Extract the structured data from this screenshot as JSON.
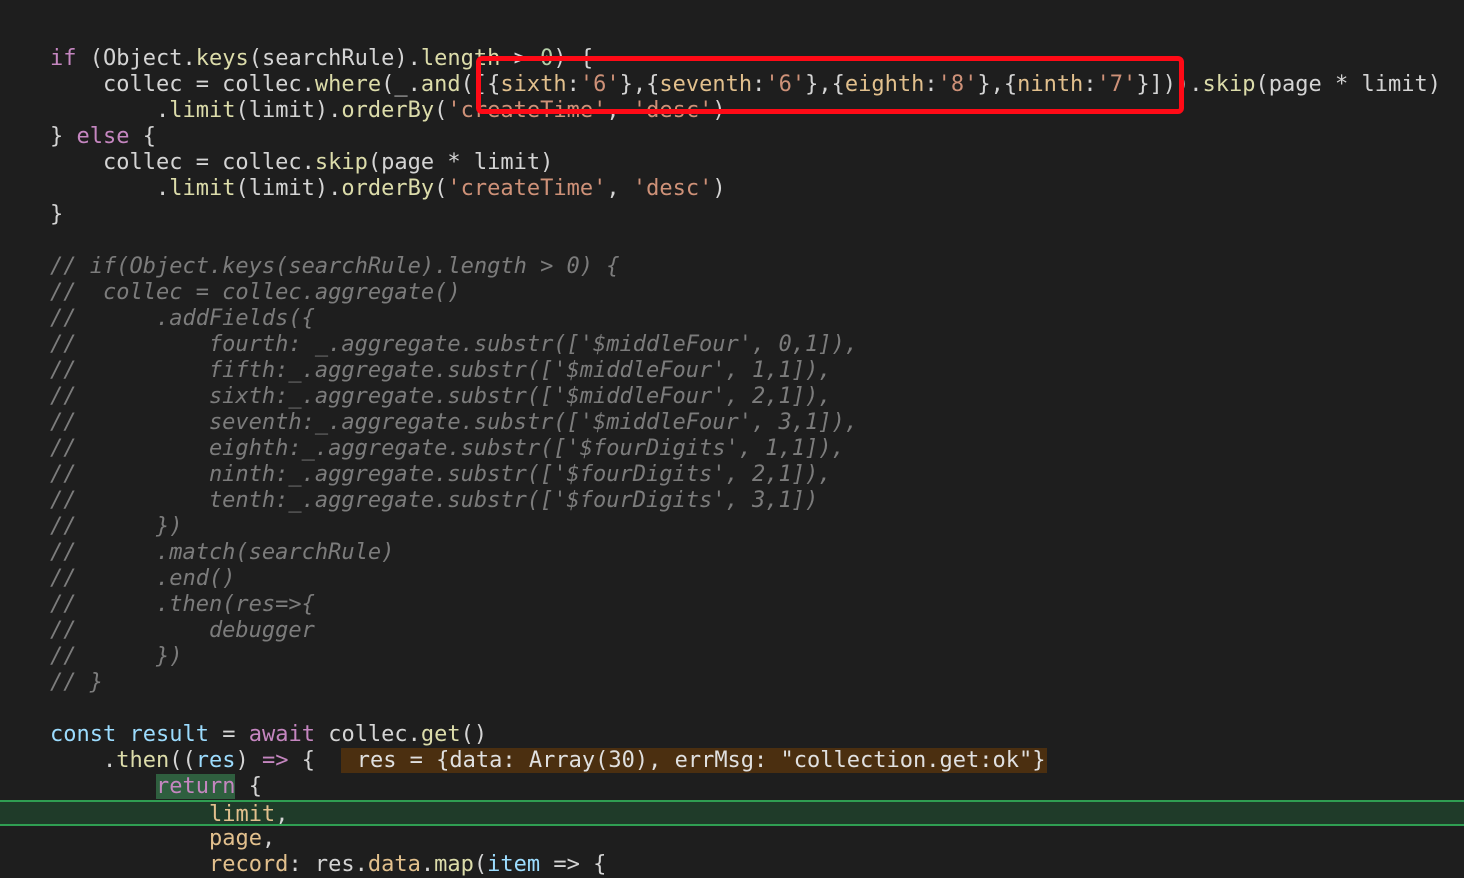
{
  "lines": [
    {
      "tokens": []
    },
    {
      "tokens": [
        {
          "t": "if",
          "c": "t-kw"
        },
        {
          "t": " (Object.",
          "c": "t-plain"
        },
        {
          "t": "keys",
          "c": "t-fn"
        },
        {
          "t": "(searchRule).",
          "c": "t-plain"
        },
        {
          "t": "length",
          "c": "t-fn"
        },
        {
          "t": " > ",
          "c": "t-op"
        },
        {
          "t": "0",
          "c": "t-num"
        },
        {
          "t": ") {",
          "c": "t-plain"
        }
      ]
    },
    {
      "tokens": [
        {
          "t": "    collec = collec.",
          "c": "t-plain"
        },
        {
          "t": "where",
          "c": "t-fn"
        },
        {
          "t": "(_.",
          "c": "t-plain"
        },
        {
          "t": "and",
          "c": "t-fn"
        },
        {
          "t": "([{",
          "c": "t-plain"
        },
        {
          "t": "sixth",
          "c": "t-prop"
        },
        {
          "t": ":",
          "c": "t-plain"
        },
        {
          "t": "'6'",
          "c": "t-str"
        },
        {
          "t": "},{",
          "c": "t-plain"
        },
        {
          "t": "seventh",
          "c": "t-prop"
        },
        {
          "t": ":",
          "c": "t-plain"
        },
        {
          "t": "'6'",
          "c": "t-str"
        },
        {
          "t": "},{",
          "c": "t-plain"
        },
        {
          "t": "eighth",
          "c": "t-prop"
        },
        {
          "t": ":",
          "c": "t-plain"
        },
        {
          "t": "'8'",
          "c": "t-str"
        },
        {
          "t": "},{",
          "c": "t-plain"
        },
        {
          "t": "ninth",
          "c": "t-prop"
        },
        {
          "t": ":",
          "c": "t-plain"
        },
        {
          "t": "'7'",
          "c": "t-str"
        },
        {
          "t": "}])).",
          "c": "t-plain"
        },
        {
          "t": "skip",
          "c": "t-fn"
        },
        {
          "t": "(page ",
          "c": "t-plain"
        },
        {
          "t": "*",
          "c": "t-op"
        },
        {
          "t": " limit)",
          "c": "t-plain"
        }
      ]
    },
    {
      "tokens": [
        {
          "t": "        .",
          "c": "t-plain"
        },
        {
          "t": "limit",
          "c": "t-fn"
        },
        {
          "t": "(limit).",
          "c": "t-plain"
        },
        {
          "t": "orderBy",
          "c": "t-fn"
        },
        {
          "t": "(",
          "c": "t-plain"
        },
        {
          "t": "'createTime'",
          "c": "t-str"
        },
        {
          "t": ", ",
          "c": "t-plain"
        },
        {
          "t": "'desc'",
          "c": "t-str"
        },
        {
          "t": ")",
          "c": "t-plain"
        }
      ]
    },
    {
      "tokens": [
        {
          "t": "} ",
          "c": "t-plain"
        },
        {
          "t": "else",
          "c": "t-kw"
        },
        {
          "t": " {",
          "c": "t-plain"
        }
      ]
    },
    {
      "tokens": [
        {
          "t": "    collec = collec.",
          "c": "t-plain"
        },
        {
          "t": "skip",
          "c": "t-fn"
        },
        {
          "t": "(page ",
          "c": "t-plain"
        },
        {
          "t": "*",
          "c": "t-op"
        },
        {
          "t": " limit)",
          "c": "t-plain"
        }
      ]
    },
    {
      "tokens": [
        {
          "t": "        .",
          "c": "t-plain"
        },
        {
          "t": "limit",
          "c": "t-fn"
        },
        {
          "t": "(limit).",
          "c": "t-plain"
        },
        {
          "t": "orderBy",
          "c": "t-fn"
        },
        {
          "t": "(",
          "c": "t-plain"
        },
        {
          "t": "'createTime'",
          "c": "t-str"
        },
        {
          "t": ", ",
          "c": "t-plain"
        },
        {
          "t": "'desc'",
          "c": "t-str"
        },
        {
          "t": ")",
          "c": "t-plain"
        }
      ]
    },
    {
      "tokens": [
        {
          "t": "}",
          "c": "t-plain"
        }
      ]
    },
    {
      "tokens": []
    },
    {
      "tokens": [
        {
          "t": "// if(Object.keys(searchRule).length > 0) {",
          "c": "t-cmt"
        }
      ]
    },
    {
      "tokens": [
        {
          "t": "//  collec = collec.aggregate()",
          "c": "t-cmt"
        }
      ]
    },
    {
      "tokens": [
        {
          "t": "//      .addFields({",
          "c": "t-cmt"
        }
      ]
    },
    {
      "tokens": [
        {
          "t": "//          fourth: _.aggregate.substr(['$middleFour', 0,1]),",
          "c": "t-cmt"
        }
      ]
    },
    {
      "tokens": [
        {
          "t": "//          fifth:_.aggregate.substr(['$middleFour', 1,1]),",
          "c": "t-cmt"
        }
      ]
    },
    {
      "tokens": [
        {
          "t": "//          sixth:_.aggregate.substr(['$middleFour', 2,1]),",
          "c": "t-cmt"
        }
      ]
    },
    {
      "tokens": [
        {
          "t": "//          seventh:_.aggregate.substr(['$middleFour', 3,1]),",
          "c": "t-cmt"
        }
      ]
    },
    {
      "tokens": [
        {
          "t": "//          eighth:_.aggregate.substr(['$fourDigits', 1,1]),",
          "c": "t-cmt"
        }
      ]
    },
    {
      "tokens": [
        {
          "t": "//          ninth:_.aggregate.substr(['$fourDigits', 2,1]),",
          "c": "t-cmt"
        }
      ]
    },
    {
      "tokens": [
        {
          "t": "//          tenth:_.aggregate.substr(['$fourDigits', 3,1])",
          "c": "t-cmt"
        }
      ]
    },
    {
      "tokens": [
        {
          "t": "//      })",
          "c": "t-cmt"
        }
      ]
    },
    {
      "tokens": [
        {
          "t": "//      .match(searchRule)",
          "c": "t-cmt"
        }
      ]
    },
    {
      "tokens": [
        {
          "t": "//      .end()",
          "c": "t-cmt"
        }
      ]
    },
    {
      "tokens": [
        {
          "t": "//      .then(res=>{",
          "c": "t-cmt"
        }
      ]
    },
    {
      "tokens": [
        {
          "t": "//          debugger",
          "c": "t-cmt"
        }
      ]
    },
    {
      "tokens": [
        {
          "t": "//      })",
          "c": "t-cmt"
        }
      ]
    },
    {
      "tokens": [
        {
          "t": "// }",
          "c": "t-cmt"
        }
      ]
    },
    {
      "tokens": []
    },
    {
      "tokens": [
        {
          "t": "const",
          "c": "t-var"
        },
        {
          "t": " ",
          "c": "t-plain"
        },
        {
          "t": "result",
          "c": "t-var"
        },
        {
          "t": " = ",
          "c": "t-plain"
        },
        {
          "t": "await",
          "c": "t-kw"
        },
        {
          "t": " collec.",
          "c": "t-plain"
        },
        {
          "t": "get",
          "c": "t-fn"
        },
        {
          "t": "()",
          "c": "t-plain"
        }
      ]
    },
    {
      "tokens": [
        {
          "t": "    .",
          "c": "t-plain"
        },
        {
          "t": "then",
          "c": "t-fn"
        },
        {
          "t": "((",
          "c": "t-plain"
        },
        {
          "t": "res",
          "c": "t-var"
        },
        {
          "t": ") ",
          "c": "t-plain"
        },
        {
          "t": "=>",
          "c": "t-kw"
        },
        {
          "t": " {  ",
          "c": "t-plain"
        },
        {
          "t": " res = {data: Array(30), errMsg: \"collection.get:ok\"}",
          "c": "t-hint"
        }
      ]
    },
    {
      "tokens": [
        {
          "t": "        ",
          "c": "t-plain"
        },
        {
          "t": "return",
          "c": "t-kw ret-hl"
        },
        {
          "t": " {",
          "c": "t-plain"
        }
      ]
    },
    {
      "tokens": [
        {
          "t": "            ",
          "c": "t-plain"
        },
        {
          "t": "limit",
          "c": "t-prop"
        },
        {
          "t": ",",
          "c": "t-plain"
        }
      ]
    },
    {
      "tokens": [
        {
          "t": "            ",
          "c": "t-plain"
        },
        {
          "t": "page",
          "c": "t-prop"
        },
        {
          "t": ",",
          "c": "t-plain"
        }
      ]
    },
    {
      "tokens": [
        {
          "t": "            ",
          "c": "t-plain"
        },
        {
          "t": "record",
          "c": "t-prop"
        },
        {
          "t": ": res.",
          "c": "t-plain"
        },
        {
          "t": "data",
          "c": "t-prop"
        },
        {
          "t": ".",
          "c": "t-plain"
        },
        {
          "t": "map",
          "c": "t-fn"
        },
        {
          "t": "(",
          "c": "t-plain"
        },
        {
          "t": "item",
          "c": "t-var"
        },
        {
          "t": " => {",
          "c": "t-plain"
        }
      ]
    }
  ],
  "current_line_index": 30,
  "annotation": {
    "color": "#ff0a16"
  }
}
